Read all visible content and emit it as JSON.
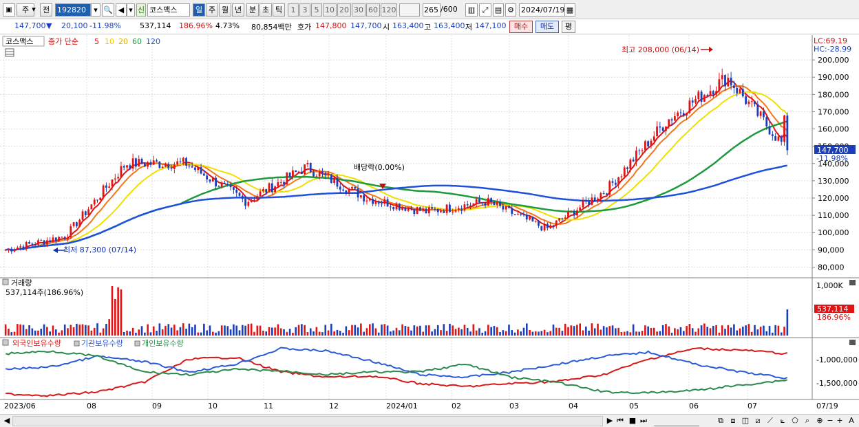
{
  "toolbar": {
    "period_select": "주",
    "prev_label": "전",
    "code": "192820",
    "new_badge": "신",
    "stock_name": "코스맥스",
    "periods": [
      "일",
      "주",
      "월",
      "년",
      "분",
      "초",
      "틱"
    ],
    "active_period": "일",
    "tick_counts": [
      "1",
      "3",
      "5",
      "10",
      "20",
      "30",
      "60",
      "120"
    ],
    "count_display": "265",
    "count_total": "/600",
    "date": "2024/07/19"
  },
  "infobar": {
    "price": "147,700",
    "change_arrow": "▼",
    "change": "20,100",
    "change_pct": "-11.98%",
    "volume": "537,114",
    "volume_ratio": "186.96%",
    "turnover": "4.73%",
    "amount": "80,854백만",
    "quote_label": "호가",
    "ask": "147,800",
    "bid": "147,700",
    "open_label": "시",
    "open": "163,400",
    "high_label": "고",
    "high": "163,400",
    "low_label": "저",
    "low": "147,100",
    "buy_button": "매수",
    "sell_button": "매도",
    "avg_button": "평"
  },
  "price_panel": {
    "legend_name": "코스맥스",
    "legend_ma": "종가 단순",
    "ma_periods": [
      "5",
      "10",
      "20",
      "60",
      "120"
    ],
    "ma_colors": [
      "#e01414",
      "#f07818",
      "#f0e000",
      "#1e9a3c",
      "#1e50dc"
    ],
    "lc_label": "LC:69.19",
    "hc_label": "HC:-28.99",
    "high_annotation": "최고 208,000 (06/14)",
    "low_annotation": "최저 87,300 (07/14)",
    "dividend_annotation": "배당락(0.00%)",
    "axis": [
      "200,000",
      "190,000",
      "180,000",
      "170,000",
      "160,000",
      "150,000",
      "140,000",
      "130,000",
      "120,000",
      "110,000",
      "100,000",
      "90,000",
      "80,000"
    ],
    "current_price_tag": "147,700",
    "current_pct_tag": "-11.98%"
  },
  "volume_panel": {
    "title": "거래량",
    "value": "537,114주(186.96%)",
    "axis_top": "1,000K",
    "tag_value": "537,114",
    "tag_pct": "186.96%"
  },
  "holding_panel": {
    "legend": [
      "외국인보유수량",
      "기관보유수량",
      "개인보유수량"
    ],
    "colors": [
      "#d81818",
      "#2a5ad8",
      "#2a8a4a"
    ],
    "axis": [
      "-1,000,000",
      "-1,500,000"
    ]
  },
  "x_axis": [
    "2023/06",
    "08",
    "09",
    "10",
    "11",
    "12",
    "2024/01",
    "02",
    "03",
    "04",
    "05",
    "06",
    "07",
    "07/19"
  ],
  "chart_data": {
    "type": "candlestick",
    "title": "코스맥스",
    "y_unit": "KRW",
    "ylim": [
      75000,
      212000
    ],
    "monthly_close_approx": [
      {
        "month": "2023/06",
        "close": 90000
      },
      {
        "month": "2023/07",
        "close": 98000
      },
      {
        "month": "2023/08",
        "close": 140000
      },
      {
        "month": "2023/09",
        "close": 140000
      },
      {
        "month": "2023/10",
        "close": 118000
      },
      {
        "month": "2023/11",
        "close": 138000
      },
      {
        "month": "2023/12",
        "close": 120000
      },
      {
        "month": "2024/01",
        "close": 112000
      },
      {
        "month": "2024/02",
        "close": 118000
      },
      {
        "month": "2024/03",
        "close": 102000
      },
      {
        "month": "2024/04",
        "close": 125000
      },
      {
        "month": "2024/05",
        "close": 165000
      },
      {
        "month": "2024/06",
        "close": 190000
      },
      {
        "month": "2024/07",
        "close": 147700
      }
    ],
    "high": {
      "value": 208000,
      "date": "06/14"
    },
    "low": {
      "value": 87300,
      "date": "07/14"
    }
  }
}
